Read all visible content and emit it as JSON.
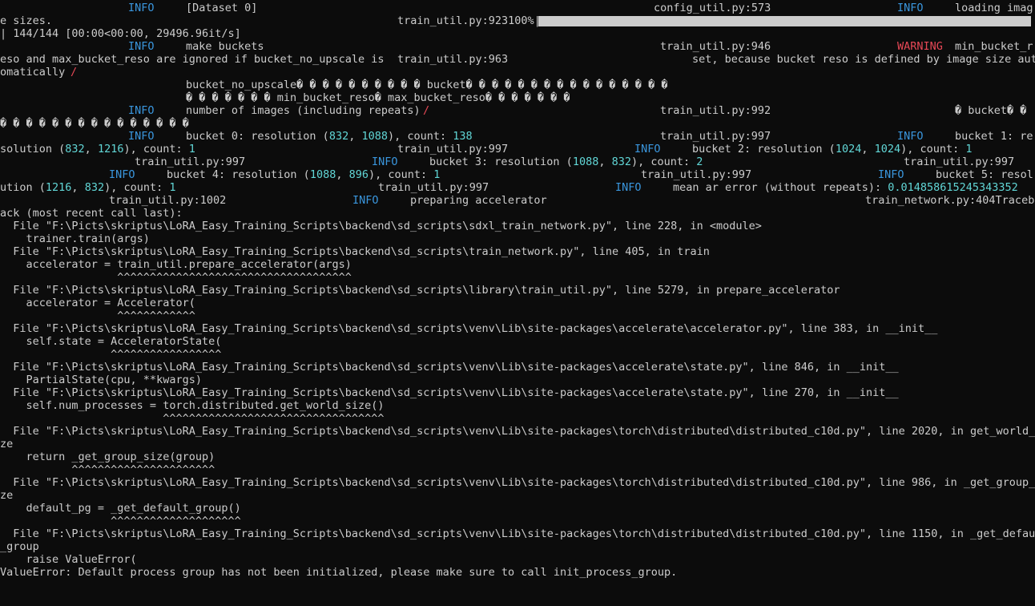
{
  "terminal": {
    "r1": {
      "info": "INFO",
      "dataset": "[Dataset 0]",
      "src": "config_util.py:573",
      "info2": "INFO",
      "msg2": "loading imag"
    },
    "r2": {
      "msg": "e sizes.",
      "progress": "train_util.py:923100%|",
      "progress_fill_pct": 100
    },
    "r3": {
      "msg": "| 144/144 [00:00<00:00, 29496.96it/s]"
    },
    "r4": {
      "info": "INFO",
      "msg": "make buckets",
      "src": "train_util.py:946",
      "warn": "WARNING",
      "msg2": "min_bucket_r"
    },
    "r5": {
      "msg": "eso and max_bucket_reso are ignored if bucket_no_upscale is",
      "src": "train_util.py:963",
      "msg2": "set, because bucket reso is defined by image size aut"
    },
    "r6": {
      "msg": "omatically",
      "slash": "/"
    },
    "r7": {
      "msg": "bucket_no_upscale� � � � � � � � � � bucket� � � � � � � � � � � � � � � �"
    },
    "r8": {
      "msg": "� � � � � � � min_bucket_reso� max_bucket_reso� � � � � � �"
    },
    "r9": {
      "info": "INFO",
      "msg": "number of images (including repeats)",
      "slash": "/",
      "src": "train_util.py:992",
      "msg2": "� bucket� �"
    },
    "r10": {
      "msg": "� � � � � � � � � � � � � � �"
    },
    "r11": {
      "info": "INFO",
      "msg_a": "bucket 0: resolution (",
      "n1": "832",
      "msg_b": ", ",
      "n2": "1088",
      "msg_c": "), count: ",
      "n3": "138",
      "src": "train_util.py:997",
      "info2": "INFO",
      "msg2": "bucket 1: re"
    },
    "r12": {
      "msg_a": "solution (",
      "n1": "832",
      "msg_b": ", ",
      "n2": "1216",
      "msg_c": "), count: ",
      "n3": "1",
      "src": "train_util.py:997",
      "info": "INFO",
      "msg2_a": "bucket 2: resolution (",
      "n4": "1024",
      "msg2_b": ", ",
      "n5": "1024",
      "msg2_c": "), count: ",
      "n6": "1"
    },
    "r13": {
      "src": "train_util.py:997",
      "info": "INFO",
      "msg_a": "bucket 3: resolution (",
      "n1": "1088",
      "msg_b": ", ",
      "n2": "832",
      "msg_c": "), count: ",
      "n3": "2",
      "src2": "train_util.py:997"
    },
    "r14": {
      "info": "INFO",
      "msg_a": "bucket 4: resolution (",
      "n1": "1088",
      "msg_b": ", ",
      "n2": "896",
      "msg_c": "), count: ",
      "n3": "1",
      "src": "train_util.py:997",
      "info2": "INFO",
      "msg2": "bucket 5: resol"
    },
    "r15": {
      "msg_a": "ution (",
      "n1": "1216",
      "msg_b": ", ",
      "n2": "832",
      "msg_c": "), count: ",
      "n3": "1",
      "src": "train_util.py:997",
      "info": "INFO",
      "msg2": "mean ar error (without repeats): ",
      "n4": "0.014858615245343352"
    },
    "r16": {
      "src": "train_util.py:1002",
      "info": "INFO",
      "msg": "preparing accelerator",
      "src2": "train_network.py:404Traceb"
    },
    "r17": {
      "msg": "ack (most recent call last):"
    },
    "r18": {
      "msg": "  File \"F:\\Picts\\skriptus\\LoRA_Easy_Training_Scripts\\backend\\sd_scripts\\sdxl_train_network.py\", line 228, in <module>"
    },
    "r19": {
      "msg": "    trainer.train(args)"
    },
    "r20": {
      "msg": "  File \"F:\\Picts\\skriptus\\LoRA_Easy_Training_Scripts\\backend\\sd_scripts\\train_network.py\", line 405, in train"
    },
    "r21": {
      "msg": "    accelerator = train_util.prepare_accelerator(args)"
    },
    "r22": {
      "msg": "                  ^^^^^^^^^^^^^^^^^^^^^^^^^^^^^^^^^^^^"
    },
    "r24": {
      "msg": "  File \"F:\\Picts\\skriptus\\LoRA_Easy_Training_Scripts\\backend\\sd_scripts\\library\\train_util.py\", line 5279, in prepare_accelerator"
    },
    "r25": {
      "msg": "    accelerator = Accelerator("
    },
    "r26": {
      "msg": "                  ^^^^^^^^^^^^"
    },
    "r28": {
      "msg": "  File \"F:\\Picts\\skriptus\\LoRA_Easy_Training_Scripts\\backend\\sd_scripts\\venv\\Lib\\site-packages\\accelerate\\accelerator.py\", line 383, in __init__"
    },
    "r29": {
      "msg": "    self.state = AcceleratorState("
    },
    "r30": {
      "msg": "                 ^^^^^^^^^^^^^^^^^"
    },
    "r32": {
      "msg": "  File \"F:\\Picts\\skriptus\\LoRA_Easy_Training_Scripts\\backend\\sd_scripts\\venv\\Lib\\site-packages\\accelerate\\state.py\", line 846, in __init__"
    },
    "r33": {
      "msg": "    PartialState(cpu, **kwargs)"
    },
    "r34": {
      "msg": "  File \"F:\\Picts\\skriptus\\LoRA_Easy_Training_Scripts\\backend\\sd_scripts\\venv\\Lib\\site-packages\\accelerate\\state.py\", line 270, in __init__"
    },
    "r35": {
      "msg": "    self.num_processes = torch.distributed.get_world_size()"
    },
    "r36": {
      "msg": "                         ^^^^^^^^^^^^^^^^^^^^^^^^^^^^^^^^^^"
    },
    "r38": {
      "msg": "  File \"F:\\Picts\\skriptus\\LoRA_Easy_Training_Scripts\\backend\\sd_scripts\\venv\\Lib\\site-packages\\torch\\distributed\\distributed_c10d.py\", line 2020, in get_world_si"
    },
    "r39": {
      "msg": "ze"
    },
    "r40": {
      "msg": "    return _get_group_size(group)"
    },
    "r41": {
      "msg": "           ^^^^^^^^^^^^^^^^^^^^^^"
    },
    "r42": {
      "msg": "  File \"F:\\Picts\\skriptus\\LoRA_Easy_Training_Scripts\\backend\\sd_scripts\\venv\\Lib\\site-packages\\torch\\distributed\\distributed_c10d.py\", line 986, in _get_group_si"
    },
    "r43": {
      "msg": "ze"
    },
    "r44": {
      "msg": "    default_pg = _get_default_group()"
    },
    "r45": {
      "msg": "                 ^^^^^^^^^^^^^^^^^^^^"
    },
    "r47": {
      "msg": "  File \"F:\\Picts\\skriptus\\LoRA_Easy_Training_Scripts\\backend\\sd_scripts\\venv\\Lib\\site-packages\\torch\\distributed\\distributed_c10d.py\", line 1150, in _get_default"
    },
    "r48": {
      "msg": "_group"
    },
    "r49": {
      "msg": "    raise ValueError("
    },
    "r50": {
      "msg": "ValueError: Default process group has not been initialized, please make sure to call init_process_group."
    }
  }
}
